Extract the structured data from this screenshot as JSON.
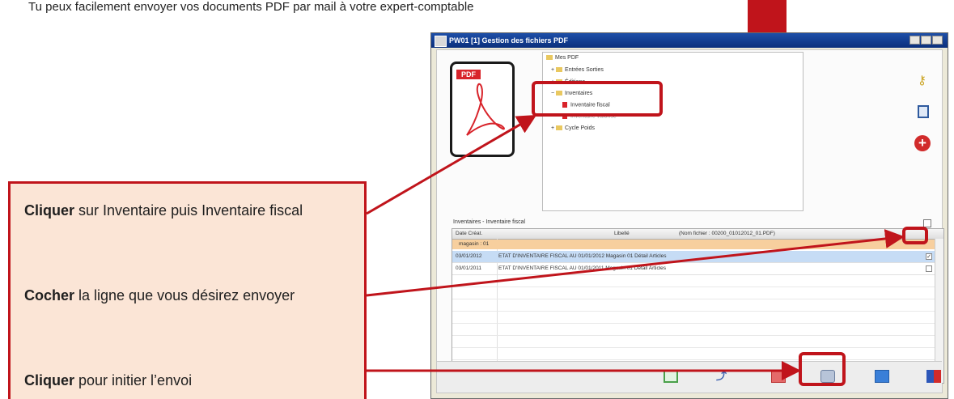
{
  "intro_text": "Tu peux facilement envoyer vos documents PDF par mail à votre expert-comptable",
  "window": {
    "title": "PW01 [1] Gestion des fichiers PDF",
    "tree": [
      {
        "label": "Mes PDF",
        "level": 0
      },
      {
        "label": "Entrées Sorties",
        "level": 1
      },
      {
        "label": "Éditions",
        "level": 1
      },
      {
        "label": "Inventaires",
        "level": 1
      },
      {
        "label": "Inventaire fiscal",
        "level": 2,
        "selected": true
      },
      {
        "label": "Inventaire valorisé",
        "level": 2
      },
      {
        "label": "Cycle Poids",
        "level": 1
      }
    ],
    "grid": {
      "caption": "Inventaires - Inventaire fiscal",
      "columns": {
        "date": "Date Créat.",
        "libelle": "Libellé",
        "nom": "(Nom fichier : 00200_01012012_01.PDF)"
      },
      "group": "magasin : 01",
      "rows": [
        {
          "date": "03/01/2012",
          "libelle": "ETAT D'INVENTAIRE FISCAL AU 01/01/2012 Magasin 01 Détail Articles",
          "checked": true
        },
        {
          "date": "03/01/2011",
          "libelle": "ETAT D'INVENTAIRE FISCAL AU 01/01/2011 Magasin 01 Détail Articles",
          "checked": false
        }
      ]
    }
  },
  "callout": {
    "step1_bold": "Cliquer",
    "step1_rest": " sur Inventaire puis Inventaire fiscal",
    "step2_bold": "Cocher",
    "step2_rest": " la ligne que vous désirez envoyer",
    "step3_bold": "Cliquer",
    "step3_rest": " pour initier l’envoi"
  },
  "colors": {
    "accent_red": "#c0141b",
    "callout_bg": "#fbe5d6",
    "group_row": "#f7cf9e",
    "selected_row": "#c6dcf5"
  },
  "icons": [
    "key-icon",
    "document-icon",
    "add-icon",
    "refresh-icon",
    "pdf-export-icon",
    "mail-icon",
    "send-icon",
    "print-icon",
    "exit-icon"
  ]
}
